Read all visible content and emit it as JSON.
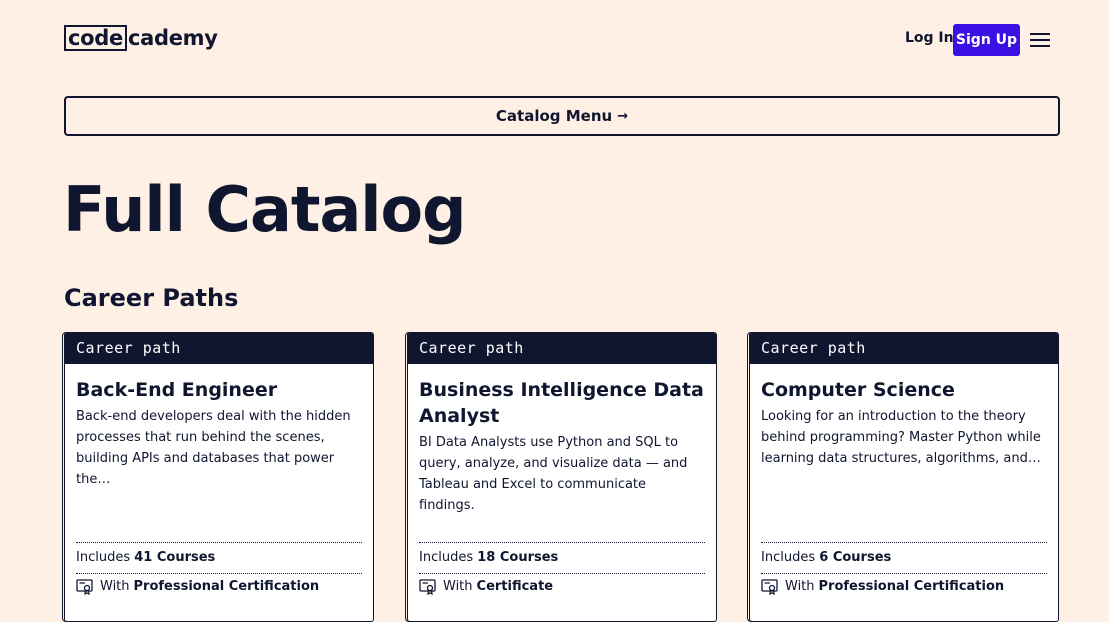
{
  "header": {
    "logo_box": "code",
    "logo_rest": "cademy",
    "login_label": "Log In",
    "signup_label": "Sign Up"
  },
  "catalog_menu": {
    "label": "Catalog Menu",
    "arrow": "→"
  },
  "page_title": "Full Catalog",
  "section_title": "Career Paths",
  "colors": {
    "background": "#fff0e5",
    "ink": "#10162f",
    "accent": "#3a10e5"
  },
  "cards": [
    {
      "tag": "Career path",
      "title": "Back-End Engineer",
      "description": "Back-end developers deal with the hidden processes that run behind the scenes, building APIs and databases that power the…",
      "includes_prefix": "Includes",
      "includes_count": "41 Courses",
      "cert_prefix": "With",
      "cert_label": "Professional Certification"
    },
    {
      "tag": "Career path",
      "title": "Business Intelligence Data Analyst",
      "description": "BI Data Analysts use Python and SQL to query, analyze, and visualize data — and Tableau and Excel to communicate findings.",
      "includes_prefix": "Includes",
      "includes_count": "18 Courses",
      "cert_prefix": "With",
      "cert_label": "Certificate"
    },
    {
      "tag": "Career path",
      "title": "Computer Science",
      "description": "Looking for an introduction to the theory behind programming? Master Python while learning data structures, algorithms, and…",
      "includes_prefix": "Includes",
      "includes_count": "6 Courses",
      "cert_prefix": "With",
      "cert_label": "Professional Certification"
    }
  ]
}
